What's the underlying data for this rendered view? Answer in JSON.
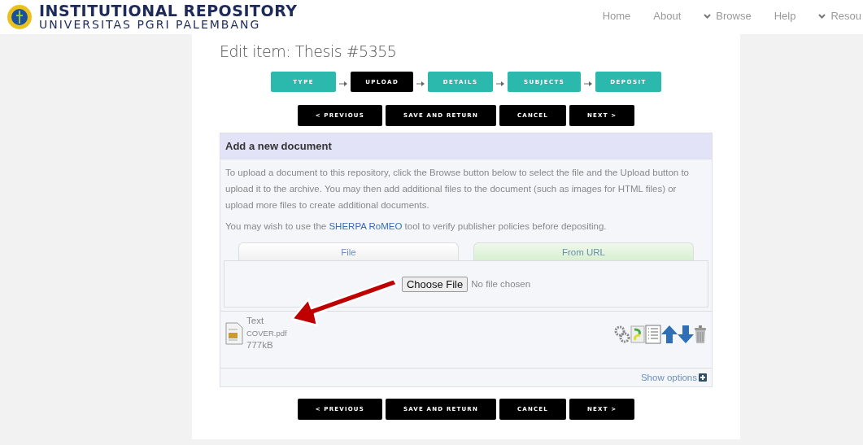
{
  "header": {
    "title": "INSTITUTIONAL REPOSITORY",
    "subtitle": "UNIVERSITAS PGRI PALEMBANG",
    "nav": [
      {
        "label": "Home",
        "dropdown": false
      },
      {
        "label": "About",
        "dropdown": false
      },
      {
        "label": "Browse",
        "dropdown": true
      },
      {
        "label": "Help",
        "dropdown": false
      },
      {
        "label": "Resou",
        "dropdown": true
      }
    ]
  },
  "page_title": "Edit item: Thesis #5355",
  "steps": [
    {
      "label": "TYPE",
      "selected": false
    },
    {
      "label": "UPLOAD",
      "selected": true
    },
    {
      "label": "DETAILS",
      "selected": false
    },
    {
      "label": "SUBJECTS",
      "selected": false
    },
    {
      "label": "DEPOSIT",
      "selected": false
    }
  ],
  "actions_top": [
    "< PREVIOUS",
    "SAVE AND RETURN",
    "CANCEL",
    "NEXT >"
  ],
  "panel": {
    "heading": "Add a new document",
    "intro": "To upload a document to this repository, click the Browse button below to select the file and the Upload button to upload it to the archive. You may then add additional files to the document (such as images for HTML files) or upload more files to create additional documents.",
    "note_before": "You may wish to use the ",
    "note_link": "SHERPA RoMEO",
    "note_after": " tool to verify publisher policies before depositing.",
    "tabs": [
      {
        "label": "File",
        "selected": true
      },
      {
        "label": "From URL",
        "selected": false
      }
    ],
    "file_button": "Choose File",
    "file_status": "No file chosen",
    "document": {
      "format": "Text",
      "filename": "COVER.pdf",
      "size": "777kB"
    },
    "show_options": "Show options"
  },
  "actions_bottom": [
    "< PREVIOUS",
    "SAVE AND RETURN",
    "CANCEL",
    "NEXT >"
  ]
}
